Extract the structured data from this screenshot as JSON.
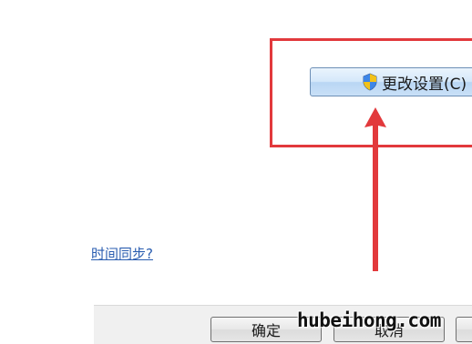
{
  "change_settings": {
    "label": "更改设置(C)",
    "icon": "uac-shield-icon"
  },
  "time_sync_link": {
    "label": "时间同步?"
  },
  "dialog_buttons": {
    "ok_label": "确定",
    "cancel_label": "取消"
  },
  "annotation": {
    "highlight_color": "#e2393c",
    "arrow_color": "#e2393c"
  },
  "watermark": {
    "text": "hubeihong.com"
  }
}
